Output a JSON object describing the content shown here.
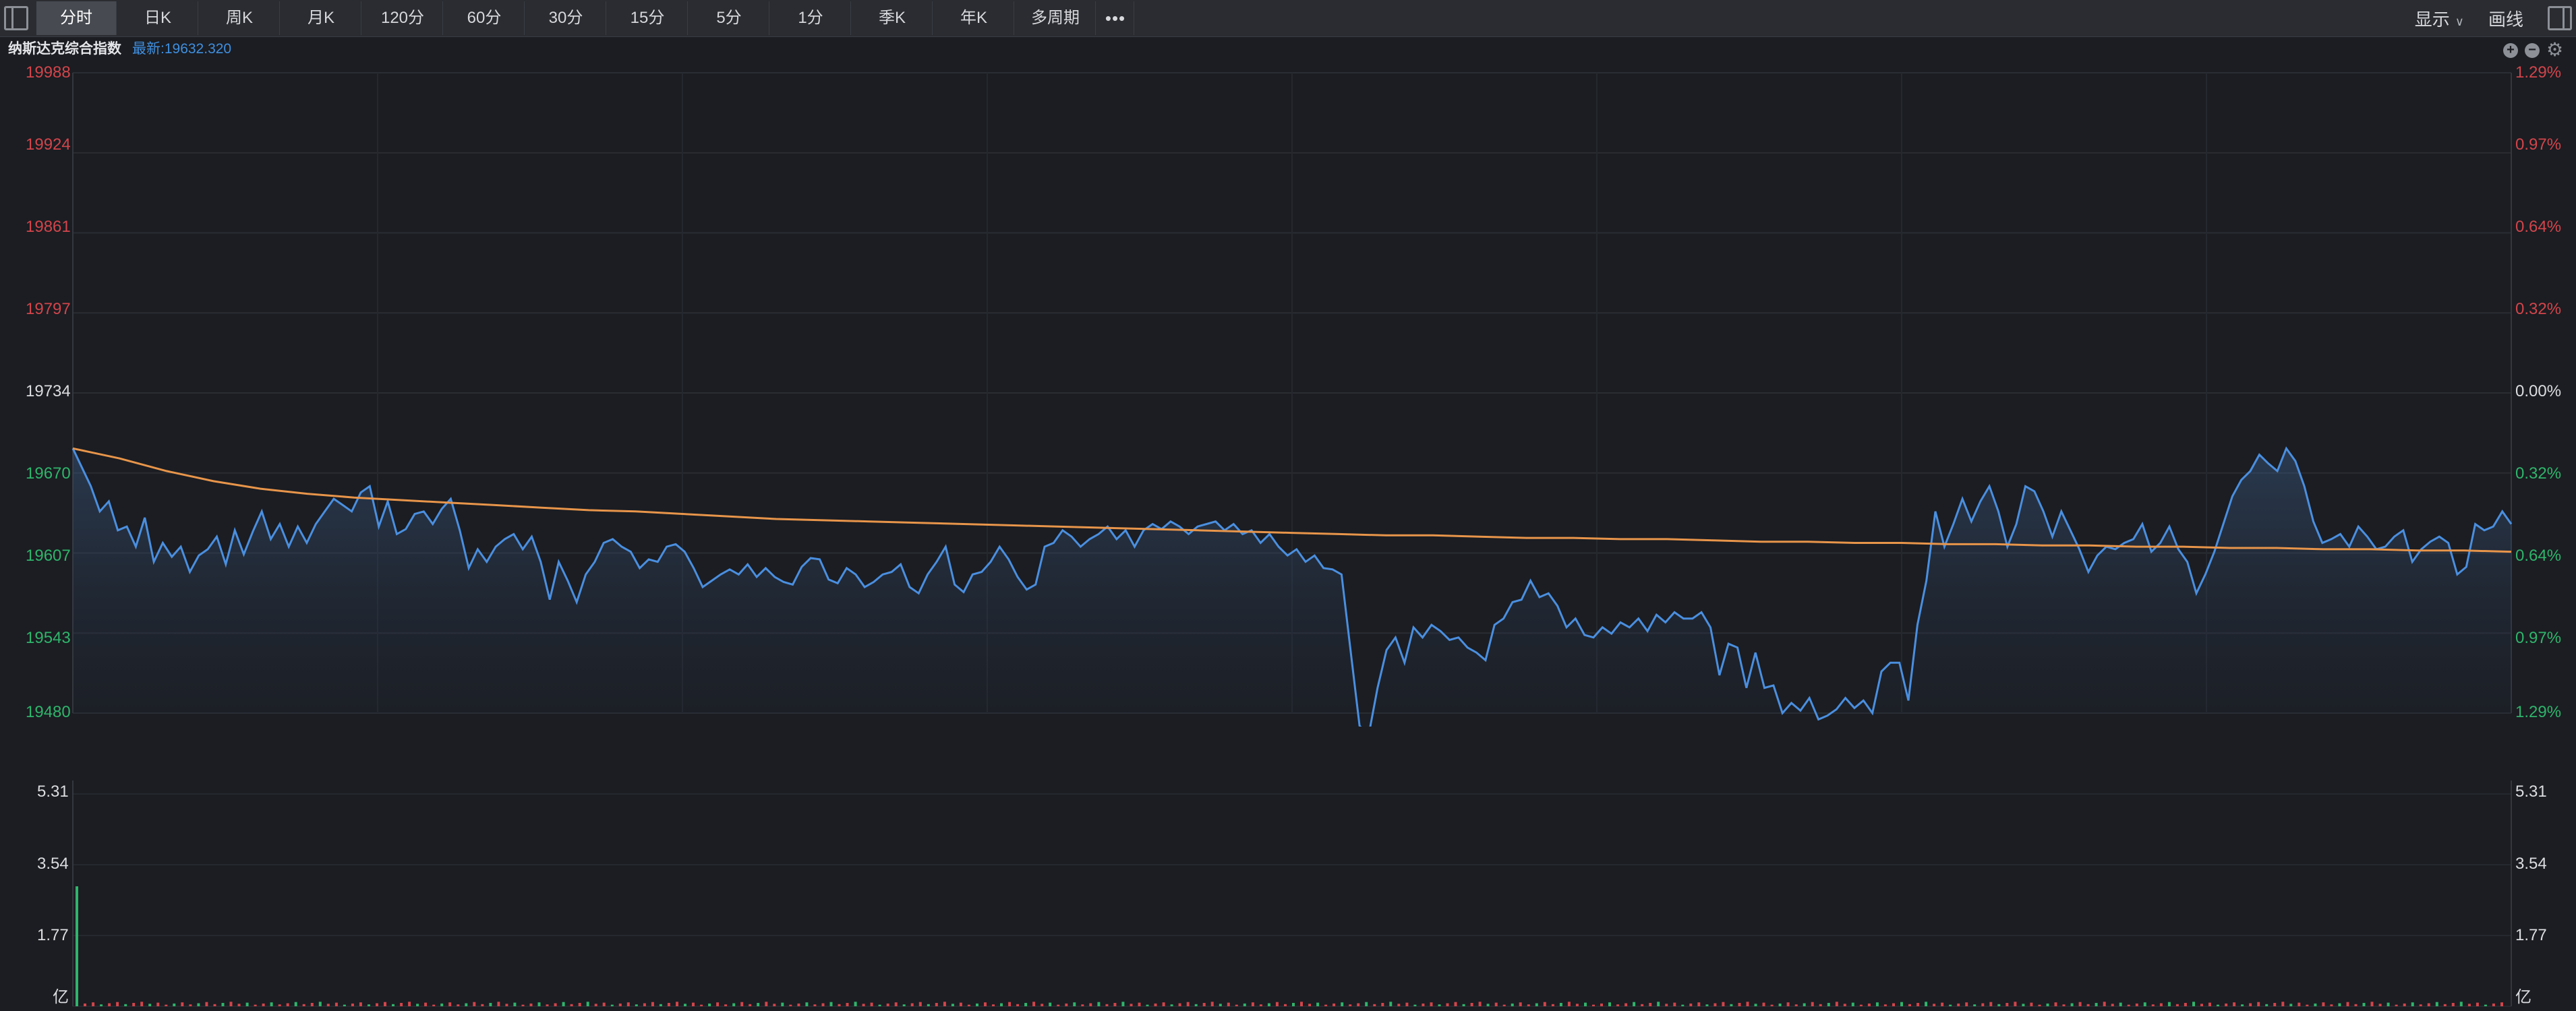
{
  "toolbar": {
    "tabs": [
      "分时",
      "日K",
      "周K",
      "月K",
      "120分",
      "60分",
      "30分",
      "15分",
      "5分",
      "1分",
      "季K",
      "年K",
      "多周期"
    ],
    "active_tab": "分时",
    "more_icon": "ellipsis-icon",
    "right_items": {
      "display": "显示",
      "draw": "画线"
    }
  },
  "info": {
    "instrument_name": "纳斯达克综合指数",
    "latest": "最新:19632.320"
  },
  "colors": {
    "up": "#d2454b",
    "down": "#2fb56b",
    "price_line": "#4a8fe0",
    "avg_line": "#e8954a",
    "background": "#1b1d22"
  },
  "price_axis": {
    "left": [
      "19988",
      "19924",
      "19861",
      "19797",
      "19734",
      "19670",
      "19607",
      "19543",
      "19480"
    ],
    "right": [
      "1.29%",
      "0.97%",
      "0.64%",
      "0.32%",
      "0.00%",
      "0.32%",
      "0.64%",
      "0.97%",
      "1.29%"
    ]
  },
  "volume_axis": {
    "left": [
      "5.31",
      "3.54",
      "1.77",
      "亿"
    ],
    "right": [
      "5.31",
      "3.54",
      "1.77",
      "亿"
    ]
  },
  "chart_data": {
    "type": "line",
    "series": [
      {
        "values": [
          19690,
          19675,
          19660,
          19640,
          19648,
          19625,
          19628,
          19612,
          19635,
          19600,
          19615,
          19604,
          19612,
          19592,
          19605,
          19610,
          19620,
          19598,
          19625,
          19606,
          19624,
          19640,
          19618,
          19630,
          19612,
          19628,
          19615,
          19630,
          19640,
          19650,
          19645,
          19640,
          19655,
          19660,
          19628,
          19648,
          19622,
          19626,
          19638,
          19640,
          19630,
          19642,
          19650,
          19625,
          19595,
          19610,
          19600,
          19612,
          19618,
          19622,
          19610,
          19620,
          19600,
          19570,
          19600,
          19585,
          19568,
          19590,
          19600,
          19615,
          19618,
          19612,
          19608,
          19595,
          19602,
          19600,
          19612,
          19614,
          19608,
          19595,
          19580,
          19585,
          19590,
          19594,
          19590,
          19598,
          19588,
          19595,
          19588,
          19584,
          19582,
          19596,
          19603,
          19602,
          19586,
          19583,
          19595,
          19590,
          19580,
          19584,
          19590,
          19592,
          19598,
          19580,
          19575,
          19590,
          19600,
          19612,
          19582,
          19576,
          19590,
          19592,
          19600,
          19612,
          19602,
          19588,
          19578,
          19582,
          19612,
          19615,
          19625,
          19620,
          19612,
          19618,
          19622,
          19628,
          19618,
          19625,
          19612,
          19625,
          19630,
          19626,
          19632,
          19628,
          19622,
          19628,
          19630,
          19632,
          19625,
          19630,
          19622,
          19625,
          19615,
          19622,
          19612,
          19605,
          19610,
          19600,
          19605,
          19595,
          19594,
          19590,
          19530,
          19470,
          19462,
          19500,
          19530,
          19540,
          19520,
          19548,
          19540,
          19550,
          19545,
          19538,
          19540,
          19532,
          19528,
          19522,
          19550,
          19555,
          19568,
          19570,
          19585,
          19572,
          19575,
          19565,
          19548,
          19555,
          19542,
          19540,
          19548,
          19543,
          19552,
          19548,
          19555,
          19545,
          19558,
          19552,
          19560,
          19555,
          19555,
          19560,
          19548,
          19510,
          19535,
          19532,
          19500,
          19528,
          19500,
          19502,
          19480,
          19488,
          19482,
          19492,
          19475,
          19478,
          19483,
          19492,
          19484,
          19490,
          19480,
          19513,
          19520,
          19520,
          19490,
          19550,
          19585,
          19640,
          19612,
          19630,
          19650,
          19632,
          19648,
          19660,
          19640,
          19612,
          19630,
          19660,
          19656,
          19640,
          19620,
          19640,
          19625,
          19610,
          19592,
          19605,
          19612,
          19610,
          19615,
          19618,
          19630,
          19608,
          19615,
          19628,
          19610,
          19600,
          19575,
          19590,
          19608,
          19630,
          19652,
          19665,
          19672,
          19685,
          19678,
          19672,
          19690,
          19680,
          19660,
          19632,
          19615,
          19618,
          19622,
          19612,
          19628,
          19620,
          19610,
          19612,
          19620,
          19625,
          19600,
          19610,
          19616,
          19620,
          19615,
          19590,
          19596,
          19630,
          19625,
          19628,
          19640,
          19630
        ],
        "color": "#4a8fe0"
      },
      {
        "values": [
          19690,
          19682,
          19672,
          19664,
          19658,
          19654,
          19651,
          19649,
          19647,
          19645,
          19643,
          19641,
          19640,
          19638,
          19636,
          19634,
          19633,
          19632,
          19631,
          19630,
          19629,
          19628,
          19627,
          19626,
          19625,
          19624,
          19623,
          19622,
          19621,
          19621,
          19620,
          19619,
          19619,
          19618,
          19618,
          19617,
          19616,
          19616,
          19615,
          19615,
          19614,
          19614,
          19613,
          19613,
          19612,
          19612,
          19611,
          19611,
          19610,
          19610,
          19609,
          19609,
          19608
        ],
        "color": "#e8954a"
      }
    ],
    "ylim": [
      19480,
      19988
    ],
    "base_value": 19734
  },
  "volume_data": {
    "type": "bar",
    "ylim": [
      0,
      5.31
    ],
    "max_value": 5.31,
    "base_bar_value": 0.08,
    "spike_value": 3.0
  }
}
